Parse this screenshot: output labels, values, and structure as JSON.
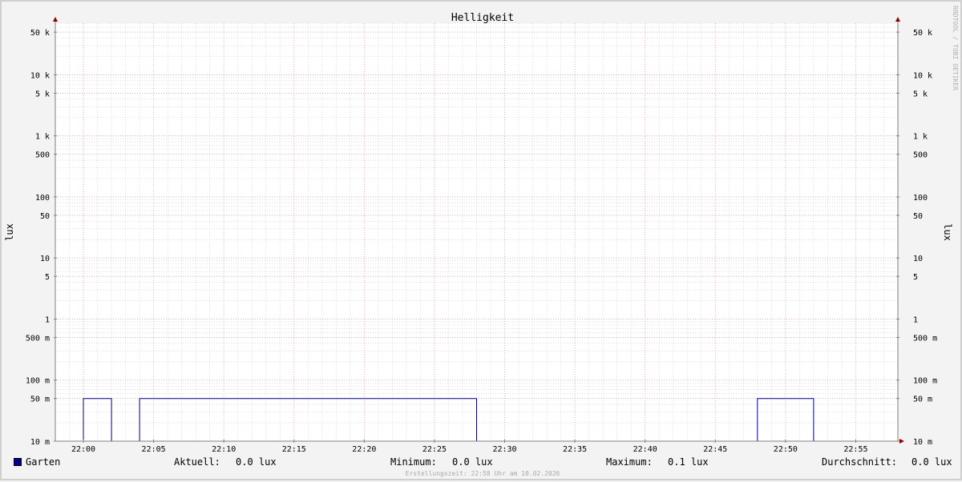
{
  "chart_data": {
    "type": "line",
    "title": "Helligkeit",
    "ylabel": "lux",
    "yscale": "log",
    "ylim": [
      0.01,
      70000
    ],
    "y_ticks": [
      {
        "value": 0.01,
        "label": "10 m"
      },
      {
        "value": 0.05,
        "label": "50 m"
      },
      {
        "value": 0.1,
        "label": "100 m"
      },
      {
        "value": 0.5,
        "label": "500 m"
      },
      {
        "value": 1,
        "label": "1"
      },
      {
        "value": 5,
        "label": "5"
      },
      {
        "value": 10,
        "label": "10"
      },
      {
        "value": 50,
        "label": "50"
      },
      {
        "value": 100,
        "label": "100"
      },
      {
        "value": 500,
        "label": "500"
      },
      {
        "value": 1000,
        "label": "1 k"
      },
      {
        "value": 5000,
        "label": "5 k"
      },
      {
        "value": 10000,
        "label": "10 k"
      },
      {
        "value": 50000,
        "label": "50 k"
      }
    ],
    "x_domain": [
      "21:58",
      "22:58"
    ],
    "x_ticks": [
      "22:00",
      "22:05",
      "22:10",
      "22:15",
      "22:20",
      "22:25",
      "22:30",
      "22:35",
      "22:40",
      "22:45",
      "22:50",
      "22:55"
    ],
    "grid": true,
    "legend_position": "bottom-left",
    "series": [
      {
        "name": "Garten",
        "color": "#00008b",
        "points": [
          {
            "x": "21:58",
            "y": 0.01
          },
          {
            "x": "22:00",
            "y": 0.01
          },
          {
            "x": "22:00",
            "y": 0.05
          },
          {
            "x": "22:02",
            "y": 0.05
          },
          {
            "x": "22:02",
            "y": 0.01
          },
          {
            "x": "22:04",
            "y": 0.01
          },
          {
            "x": "22:04",
            "y": 0.05
          },
          {
            "x": "22:28",
            "y": 0.05
          },
          {
            "x": "22:28",
            "y": 0.01
          },
          {
            "x": "22:48",
            "y": 0.01
          },
          {
            "x": "22:48",
            "y": 0.05
          },
          {
            "x": "22:52",
            "y": 0.05
          },
          {
            "x": "22:52",
            "y": 0.01
          },
          {
            "x": "22:58",
            "y": 0.01
          }
        ]
      }
    ]
  },
  "legend": {
    "series_name": "Garten",
    "current_label": "Aktuell:",
    "current_value": "0.0 lux",
    "min_label": "Minimum:",
    "min_value": "0.0 lux",
    "max_label": "Maximum:",
    "max_value": "0.1 lux",
    "avg_label": "Durchschnitt:",
    "avg_value": "0.0 lux"
  },
  "footer": "Erstellungszeit: 22:58 Uhr am 10.02.2026",
  "watermark": "RRDTOOL / TOBI OETIKER",
  "colors": {
    "background": "#f3f3f3",
    "plot_background": "#ffffff",
    "major_grid": "#e8a0a0",
    "minor_grid": "#c8c8c8",
    "axis": "#808080",
    "arrow": "#8b0000",
    "series": "#00008b",
    "footer_text": "#a8a8a8"
  }
}
